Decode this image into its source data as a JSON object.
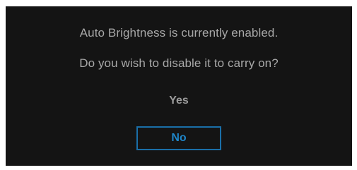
{
  "dialog": {
    "message_line1": "Auto Brightness is currently enabled.",
    "message_line2": "Do you wish to disable it to carry on?",
    "options": [
      {
        "label": "Yes",
        "selected": false
      },
      {
        "label": "No",
        "selected": true
      }
    ]
  },
  "colors": {
    "background": "#141414",
    "text": "#a8a8a8",
    "selected_accent": "#1f86c9"
  }
}
